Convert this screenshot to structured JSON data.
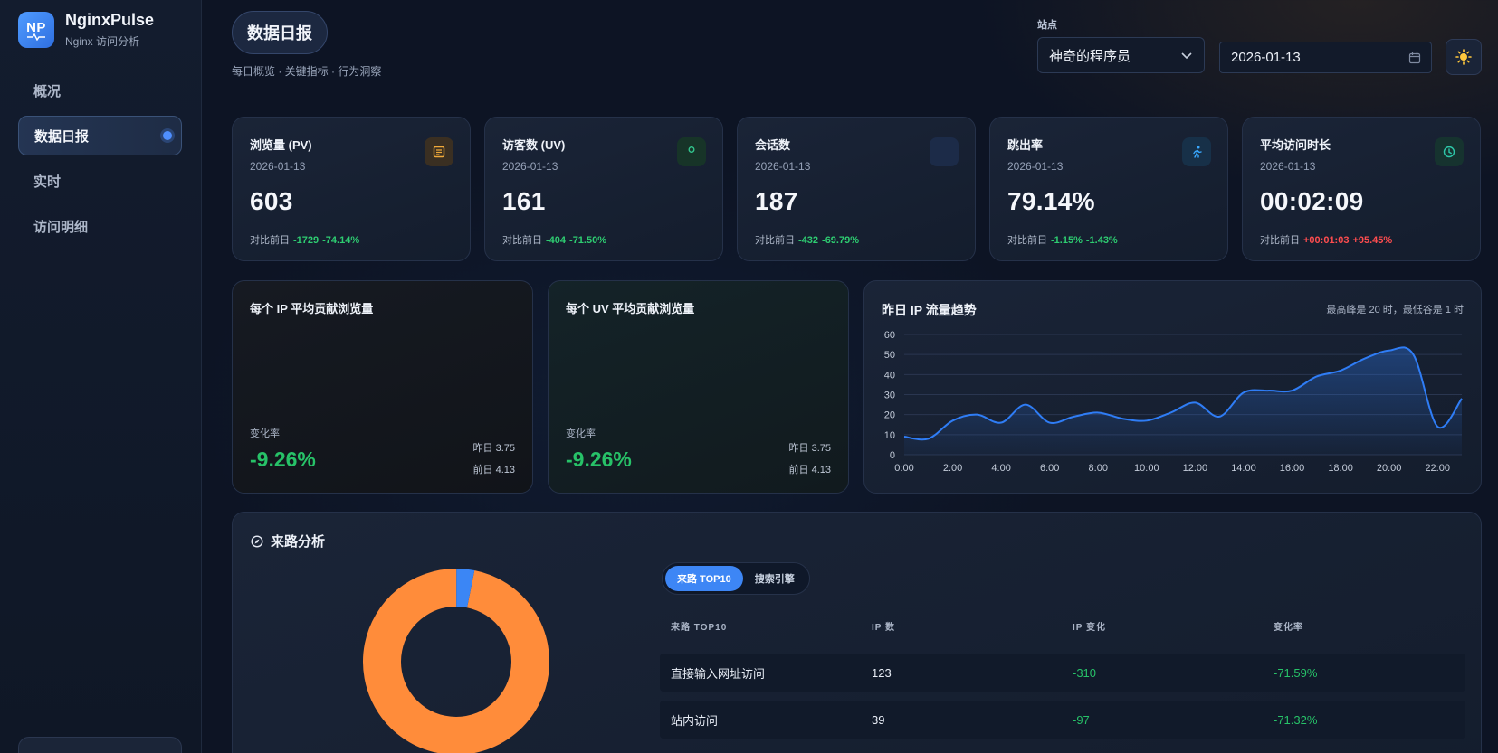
{
  "brand": {
    "logo_text": "NP",
    "name": "NginxPulse",
    "subtitle": "Nginx 访问分析"
  },
  "nav": [
    {
      "label": "概况",
      "active": false
    },
    {
      "label": "数据日报",
      "active": true
    },
    {
      "label": "实时",
      "active": false
    },
    {
      "label": "访问明细",
      "active": false
    }
  ],
  "header": {
    "title": "数据日报",
    "subtitle": "每日概览 · 关键指标 · 行为洞察",
    "site_label": "站点",
    "site_value": "神奇的程序员",
    "date_value": "2026-01-13"
  },
  "kpis": [
    {
      "title": "浏览量 (PV)",
      "date": "2026-01-13",
      "value": "603",
      "cmp_label": "对比前日",
      "delta": "-1729",
      "pct": "-74.14%",
      "trend": "down",
      "icon": "document-icon",
      "icon_color": "#f0a93a",
      "icon_bg": "#3a2f22"
    },
    {
      "title": "访客数 (UV)",
      "date": "2026-01-13",
      "value": "161",
      "cmp_label": "对比前日",
      "delta": "-404",
      "pct": "-71.50%",
      "trend": "down",
      "icon": "user-icon",
      "icon_color": "#32c48d",
      "icon_bg": "#173428"
    },
    {
      "title": "会话数",
      "date": "2026-01-13",
      "value": "187",
      "cmp_label": "对比前日",
      "delta": "-432",
      "pct": "-69.79%",
      "trend": "down",
      "icon": "chat-icon",
      "icon_color": "#5b9bff",
      "icon_bg": "#1c2b48"
    },
    {
      "title": "跳出率",
      "date": "2026-01-13",
      "value": "79.14%",
      "cmp_label": "对比前日",
      "delta": "-1.15%",
      "pct": "-1.43%",
      "trend": "down",
      "icon": "running-icon",
      "icon_color": "#39a8ff",
      "icon_bg": "#173048"
    },
    {
      "title": "平均访问时长",
      "date": "2026-01-13",
      "value": "00:02:09",
      "cmp_label": "对比前日",
      "delta": "+00:01:03",
      "pct": "+95.45%",
      "trend": "up",
      "icon": "clock-icon",
      "icon_color": "#2ec7a9",
      "icon_bg": "#16332f"
    }
  ],
  "ratio_cards": [
    {
      "title": "每个 IP 平均贡献浏览量",
      "change_label": "变化率",
      "change": "-9.26%",
      "yesterday": "昨日 3.75",
      "before": "前日 4.13"
    },
    {
      "title": "每个 UV 平均贡献浏览量",
      "change_label": "变化率",
      "change": "-9.26%",
      "yesterday": "昨日 3.75",
      "before": "前日 4.13"
    }
  ],
  "trend": {
    "title": "昨日 IP 流量趋势",
    "note": "最高峰是 20 时，最低谷是 1 时",
    "line_color": "#2f7df6"
  },
  "chart_data": {
    "type": "area",
    "x": [
      "0:00",
      "1:00",
      "2:00",
      "3:00",
      "4:00",
      "5:00",
      "6:00",
      "7:00",
      "8:00",
      "9:00",
      "10:00",
      "11:00",
      "12:00",
      "13:00",
      "14:00",
      "15:00",
      "16:00",
      "17:00",
      "18:00",
      "19:00",
      "20:00",
      "21:00",
      "22:00",
      "23:00"
    ],
    "x_ticks": [
      "0:00",
      "2:00",
      "4:00",
      "6:00",
      "8:00",
      "10:00",
      "12:00",
      "14:00",
      "16:00",
      "18:00",
      "20:00",
      "22:00"
    ],
    "series": [
      {
        "values": [
          9,
          8,
          17,
          20,
          16,
          25,
          16,
          19,
          21,
          18,
          17,
          21,
          26,
          19,
          31,
          32,
          32,
          39,
          42,
          48,
          52,
          50,
          14,
          28
        ]
      }
    ],
    "ylim": [
      0,
      60
    ],
    "y_ticks": [
      0,
      10,
      20,
      30,
      40,
      50,
      60
    ],
    "grid": true
  },
  "referrer": {
    "title": "来路分析",
    "tabs": [
      {
        "label": "来路 TOP10",
        "active": true
      },
      {
        "label": "搜索引擎",
        "active": false
      }
    ],
    "columns": [
      "来路 TOP10",
      "IP 数",
      "IP 变化",
      "变化率"
    ],
    "rows": [
      {
        "source": "直接输入网址访问",
        "ips": "123",
        "change": "-310",
        "rate": "-71.59%"
      },
      {
        "source": "站内访问",
        "ips": "39",
        "change": "-97",
        "rate": "-71.32%"
      }
    ],
    "donut": {
      "type": "pie",
      "values": [
        123,
        4
      ],
      "colors": [
        "#ff8c3a",
        "#3b86f5"
      ]
    }
  }
}
